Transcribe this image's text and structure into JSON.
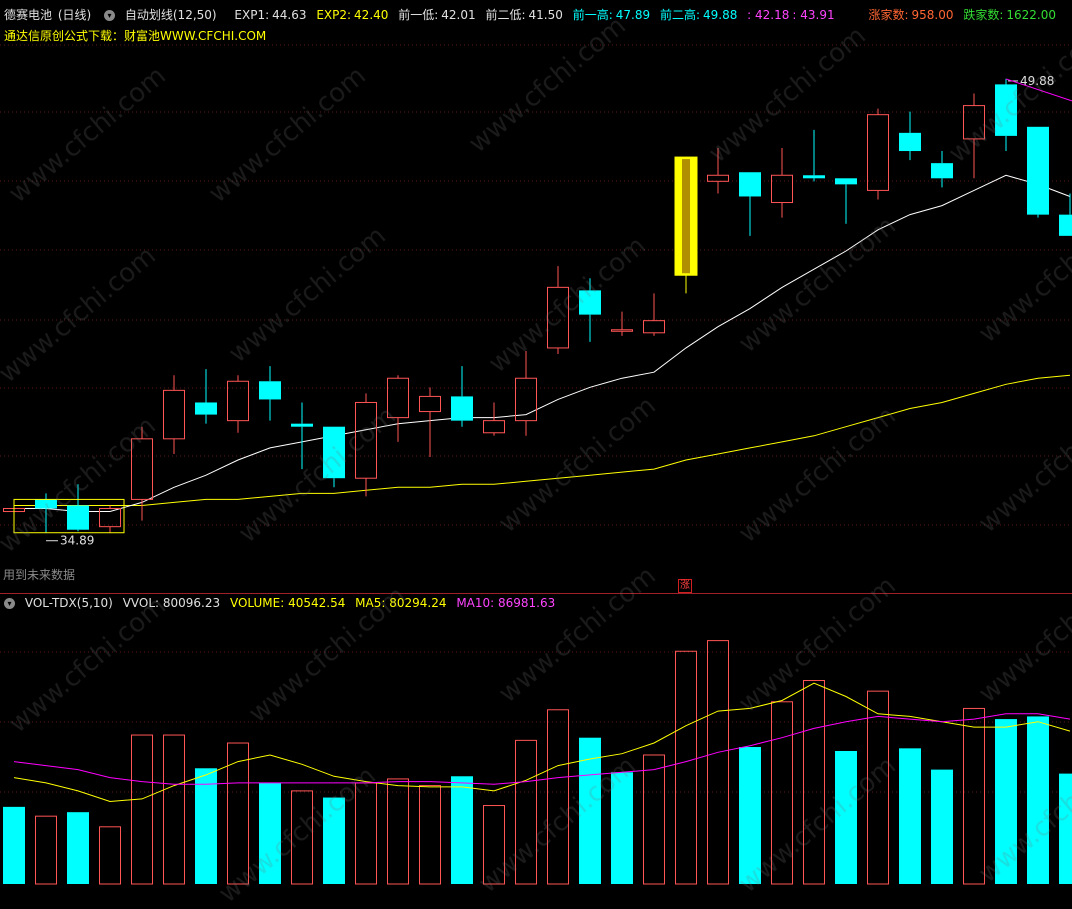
{
  "header1": {
    "stock_name": "德赛电池",
    "period": "(日线)",
    "indicator": "自动划线(12,50)",
    "exp1_label": "EXP1:",
    "exp1_value": "44.63",
    "exp2_label": "EXP2:",
    "exp2_value": "42.40",
    "low1_label": "前一低:",
    "low1_value": "42.01",
    "low2_label": "前二低:",
    "low2_value": "41.50",
    "high1_label": "前一高:",
    "high1_value": "47.89",
    "high2_label": "前二高:",
    "high2_value": "49.88",
    "extra1": ": 42.18",
    "extra2": ": 43.91",
    "up_label": "涨家数:",
    "up_value": "958.00",
    "down_label": "跌家数:",
    "down_value": "1622.00"
  },
  "header2": {
    "promo": "通达信原创公式下载：",
    "site": "财富池WWW.CFCHI.COM"
  },
  "annotations": {
    "high_price": "49.88",
    "low_price": "34.89",
    "future_text": "用到未来数据",
    "zhang": "涨"
  },
  "vol_header": {
    "name": "VOL-TDX(5,10)",
    "vvol": "VVOL: 80096.23",
    "volume": "VOLUME: 40542.54",
    "ma5": "MA5: 80294.24",
    "ma10": "MA10: 86981.63"
  },
  "watermark": "www.cfchi.com",
  "colors": {
    "up": "#ff5555",
    "down": "#00ffff",
    "highlight": "#ffff00",
    "ma_short": "#ffffff",
    "ma_long": "#ffff00",
    "vol_ma5": "#ffff00",
    "vol_ma10": "#ff00ff"
  },
  "chart_data": {
    "type": "candlestick",
    "candles": [
      {
        "o": 35.6,
        "h": 35.9,
        "l": 35.4,
        "c": 35.7
      },
      {
        "o": 36.0,
        "h": 36.2,
        "l": 34.9,
        "c": 35.7
      },
      {
        "o": 35.8,
        "h": 36.5,
        "l": 34.95,
        "c": 35.0
      },
      {
        "o": 35.1,
        "h": 35.8,
        "l": 34.9,
        "c": 35.7
      },
      {
        "o": 36.0,
        "h": 38.4,
        "l": 35.3,
        "c": 38.0
      },
      {
        "o": 38.0,
        "h": 40.1,
        "l": 37.5,
        "c": 39.6
      },
      {
        "o": 39.2,
        "h": 40.3,
        "l": 38.5,
        "c": 38.8
      },
      {
        "o": 38.6,
        "h": 40.1,
        "l": 38.2,
        "c": 39.9
      },
      {
        "o": 39.9,
        "h": 40.4,
        "l": 38.6,
        "c": 39.3
      },
      {
        "o": 38.5,
        "h": 39.2,
        "l": 37.0,
        "c": 38.4
      },
      {
        "o": 38.4,
        "h": 38.4,
        "l": 36.4,
        "c": 36.7
      },
      {
        "o": 36.7,
        "h": 39.5,
        "l": 36.1,
        "c": 39.2
      },
      {
        "o": 38.7,
        "h": 40.1,
        "l": 37.9,
        "c": 40.0
      },
      {
        "o": 38.9,
        "h": 39.7,
        "l": 37.4,
        "c": 39.4
      },
      {
        "o": 39.4,
        "h": 40.4,
        "l": 38.4,
        "c": 38.6
      },
      {
        "o": 38.2,
        "h": 39.2,
        "l": 38.1,
        "c": 38.6
      },
      {
        "o": 38.6,
        "h": 40.9,
        "l": 38.1,
        "c": 40.0
      },
      {
        "o": 41.0,
        "h": 43.7,
        "l": 40.8,
        "c": 43.0
      },
      {
        "o": 42.9,
        "h": 43.3,
        "l": 41.2,
        "c": 42.1
      },
      {
        "o": 41.6,
        "h": 42.2,
        "l": 41.4,
        "c": 41.6
      },
      {
        "o": 41.5,
        "h": 42.8,
        "l": 41.4,
        "c": 41.9
      },
      {
        "o": 43.4,
        "h": 47.3,
        "l": 42.8,
        "c": 47.3
      },
      {
        "o": 46.5,
        "h": 47.6,
        "l": 46.1,
        "c": 46.7
      },
      {
        "o": 46.8,
        "h": 46.8,
        "l": 44.7,
        "c": 46.0
      },
      {
        "o": 45.8,
        "h": 47.6,
        "l": 45.3,
        "c": 46.7
      },
      {
        "o": 46.7,
        "h": 48.2,
        "l": 46.5,
        "c": 46.6
      },
      {
        "o": 46.6,
        "h": 46.6,
        "l": 45.1,
        "c": 46.4
      },
      {
        "o": 46.2,
        "h": 48.9,
        "l": 45.9,
        "c": 48.7
      },
      {
        "o": 48.1,
        "h": 48.8,
        "l": 47.2,
        "c": 47.5
      },
      {
        "o": 47.1,
        "h": 47.5,
        "l": 46.3,
        "c": 46.6
      },
      {
        "o": 47.9,
        "h": 49.4,
        "l": 46.6,
        "c": 49.0
      },
      {
        "o": 49.7,
        "h": 49.88,
        "l": 47.5,
        "c": 48.0
      },
      {
        "o": 48.3,
        "h": 48.3,
        "l": 45.3,
        "c": 45.4
      },
      {
        "o": 45.4,
        "h": 46.1,
        "l": 44.7,
        "c": 44.7
      }
    ],
    "highlight_index": 21,
    "ma_short": [
      35.7,
      35.7,
      35.6,
      35.6,
      35.9,
      36.4,
      36.8,
      37.3,
      37.7,
      37.9,
      38.1,
      38.3,
      38.5,
      38.6,
      38.7,
      38.7,
      38.8,
      39.3,
      39.7,
      40.0,
      40.2,
      41.0,
      41.7,
      42.3,
      43.0,
      43.6,
      44.2,
      44.9,
      45.4,
      45.7,
      46.2,
      46.7,
      46.4,
      46.0
    ],
    "ma_long": [
      35.8,
      35.8,
      35.8,
      35.8,
      35.8,
      35.9,
      36.0,
      36.0,
      36.1,
      36.2,
      36.2,
      36.3,
      36.4,
      36.4,
      36.5,
      36.5,
      36.6,
      36.7,
      36.8,
      36.9,
      37.0,
      37.3,
      37.5,
      37.7,
      37.9,
      38.1,
      38.4,
      38.7,
      39.0,
      39.2,
      39.5,
      39.8,
      40.0,
      40.1
    ],
    "ylim": [
      34.0,
      51.0
    ],
    "volume": {
      "values": [
        58000,
        51000,
        54000,
        43000,
        112000,
        112000,
        87000,
        106000,
        76000,
        70000,
        65000,
        76000,
        79000,
        74000,
        81000,
        59000,
        108000,
        131000,
        110000,
        84000,
        97000,
        175000,
        183000,
        103000,
        137000,
        153000,
        100000,
        145000,
        102000,
        86000,
        132000,
        124000,
        126000,
        83000
      ],
      "up": [
        false,
        true,
        false,
        true,
        true,
        true,
        false,
        true,
        false,
        true,
        false,
        true,
        true,
        true,
        false,
        true,
        true,
        true,
        false,
        false,
        true,
        true,
        true,
        false,
        true,
        true,
        false,
        true,
        false,
        false,
        true,
        false,
        false,
        false
      ],
      "ma5": [
        80000,
        76000,
        70000,
        62000,
        64000,
        74000,
        82000,
        92000,
        97000,
        90000,
        81000,
        77000,
        74000,
        73000,
        73000,
        70000,
        78000,
        89000,
        94000,
        98000,
        106000,
        119000,
        130000,
        132000,
        138000,
        151000,
        141000,
        128000,
        126000,
        122000,
        118000,
        118000,
        122000,
        115000
      ],
      "ma10": [
        92000,
        89000,
        86000,
        80000,
        77000,
        75000,
        75000,
        76000,
        76000,
        76000,
        76000,
        76000,
        77000,
        77000,
        76000,
        75000,
        77000,
        80000,
        82000,
        84000,
        86000,
        92000,
        99000,
        104000,
        110000,
        117000,
        122000,
        126000,
        124000,
        122000,
        124000,
        128000,
        128000,
        124000
      ],
      "ylim": [
        0,
        200000
      ]
    }
  }
}
